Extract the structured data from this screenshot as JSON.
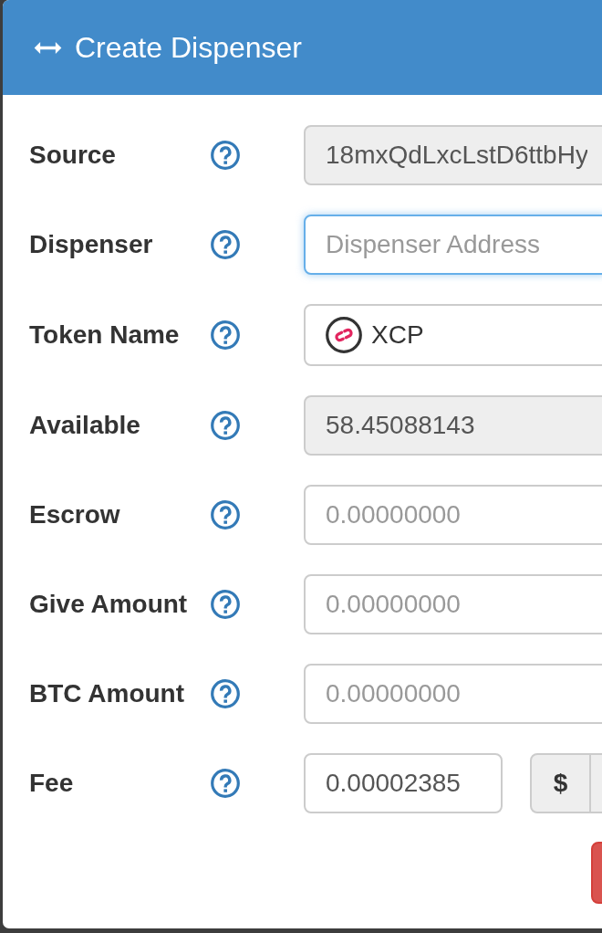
{
  "dialog": {
    "title": "Create Dispenser"
  },
  "fields": [
    {
      "kind": "text",
      "label": "Source",
      "value": "18mxQdLxcLstD6ttbHy",
      "disabled": true,
      "focused": false
    },
    {
      "kind": "text",
      "label": "Dispenser",
      "placeholder": "Dispenser Address",
      "disabled": false,
      "focused": true
    },
    {
      "kind": "token",
      "label": "Token Name",
      "value": "XCP",
      "disabled": false,
      "focused": false
    },
    {
      "kind": "text",
      "label": "Available",
      "value": "58.45088143",
      "disabled": true,
      "focused": false
    },
    {
      "kind": "text",
      "label": "Escrow",
      "placeholder": "0.00000000",
      "disabled": false,
      "focused": false
    },
    {
      "kind": "text",
      "label": "Give Amount",
      "placeholder": "0.00000000",
      "disabled": false,
      "focused": false
    },
    {
      "kind": "text",
      "label": "BTC Amount",
      "placeholder": "0.00000000",
      "disabled": false,
      "focused": false
    },
    {
      "kind": "fee",
      "label": "Fee",
      "value": "0.00002385",
      "currency_button": "$",
      "disabled": false,
      "focused": false
    }
  ]
}
